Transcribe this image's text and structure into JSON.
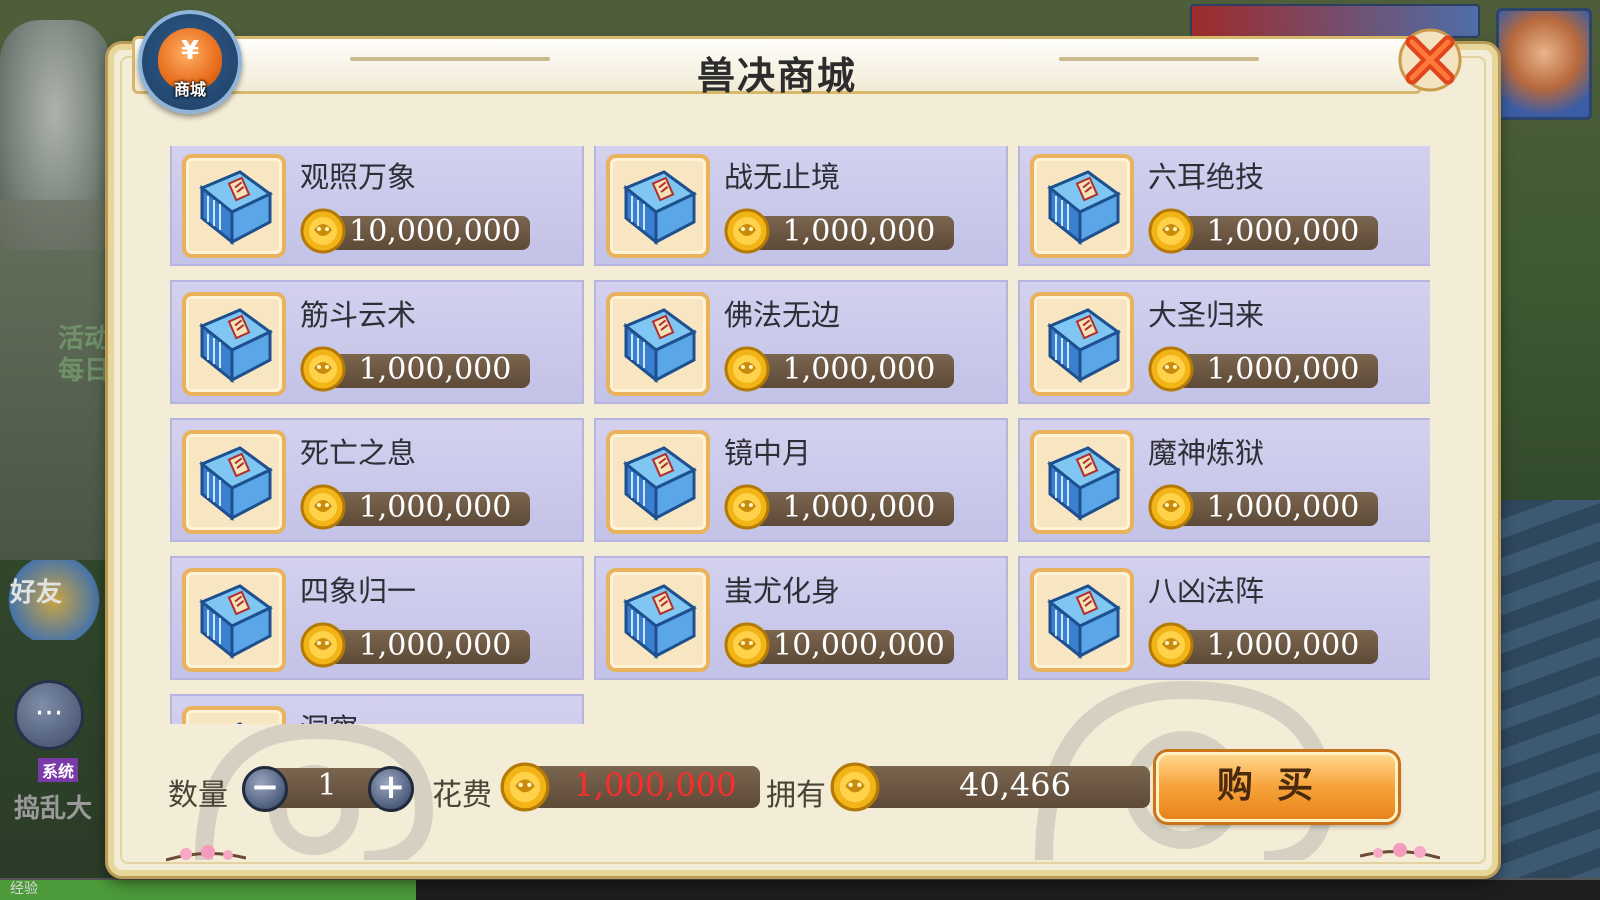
{
  "shop": {
    "title": "兽决商城",
    "badge_label": "商城",
    "badge_symbol": "¥",
    "close_icon": "close-x-icon"
  },
  "items": [
    {
      "name": "观照万象",
      "price": "10,000,000",
      "icon": "skill-book-icon"
    },
    {
      "name": "战无止境",
      "price": "1,000,000",
      "icon": "skill-book-icon"
    },
    {
      "name": "六耳绝技",
      "price": "1,000,000",
      "icon": "skill-book-icon"
    },
    {
      "name": "筋斗云术",
      "price": "1,000,000",
      "icon": "skill-book-icon"
    },
    {
      "name": "佛法无边",
      "price": "1,000,000",
      "icon": "skill-book-icon"
    },
    {
      "name": "大圣归来",
      "price": "1,000,000",
      "icon": "skill-book-icon"
    },
    {
      "name": "死亡之息",
      "price": "1,000,000",
      "icon": "skill-book-icon"
    },
    {
      "name": "镜中月",
      "price": "1,000,000",
      "icon": "skill-book-icon"
    },
    {
      "name": "魔神炼狱",
      "price": "1,000,000",
      "icon": "skill-book-icon"
    },
    {
      "name": "四象归一",
      "price": "1,000,000",
      "icon": "skill-book-icon"
    },
    {
      "name": "蚩尤化身",
      "price": "10,000,000",
      "icon": "skill-book-icon"
    },
    {
      "name": "八凶法阵",
      "price": "1,000,000",
      "icon": "skill-book-icon"
    },
    {
      "name": "洞察",
      "price": "",
      "icon": "skill-book-icon"
    }
  ],
  "purchase": {
    "quantity_label": "数量",
    "quantity": "1",
    "minus_symbol": "−",
    "plus_symbol": "+",
    "cost_label": "花费",
    "cost": "1,000,000",
    "own_label": "拥有",
    "owned": "40,466",
    "buy_label": "购买"
  },
  "background_hud": {
    "activity_label": "活动",
    "daily_label": "每日",
    "friend_label": "好友",
    "system_tag": "系统",
    "system_message": "捣乱大",
    "exp_label": "经验",
    "exp_fill_percent": 26
  },
  "colors": {
    "panel_bg": "#f3ecd6",
    "item_bg": "#c9c8ea",
    "price_bar": "#6b5642",
    "cost_text": "#ff2b2b",
    "buy_button": "#f7a23a",
    "coin_gold": "#f2b417"
  }
}
